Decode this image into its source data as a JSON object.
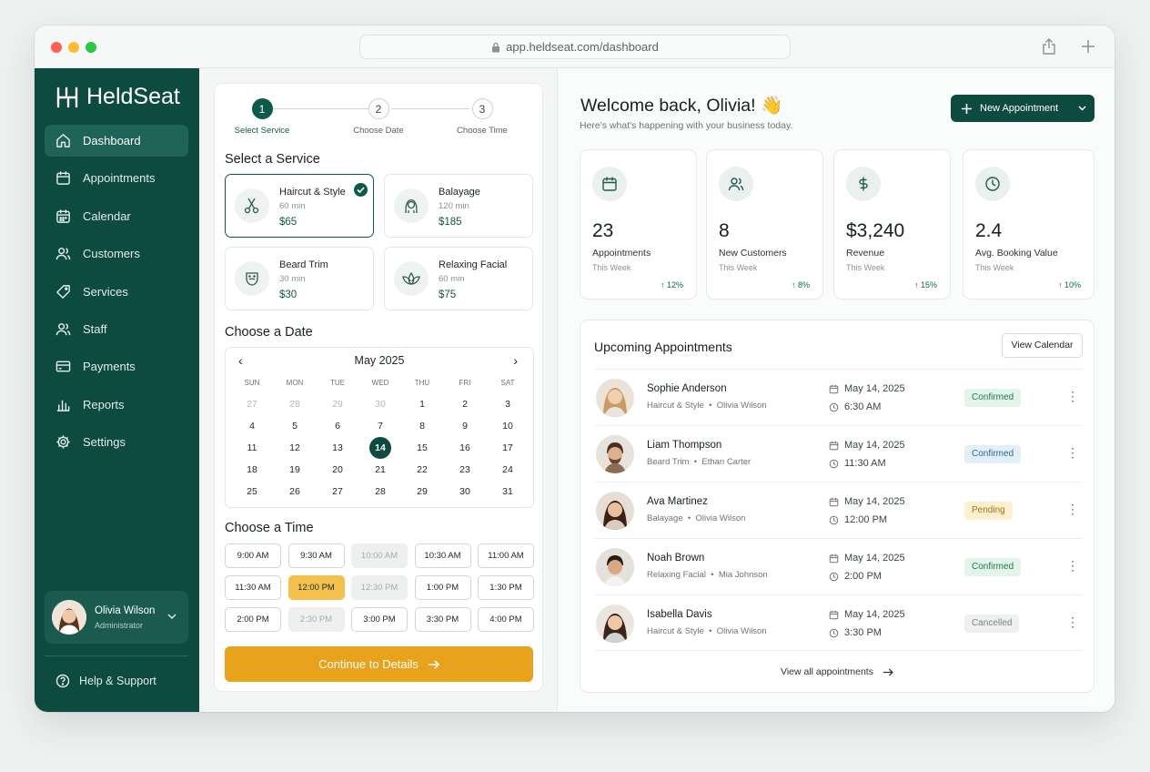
{
  "browser": {
    "url": "app.heldseat.com/dashboard"
  },
  "brand": {
    "name": "HeldSeat",
    "primary": "#0d4a40",
    "accent": "#e8a21b"
  },
  "sidebar": {
    "items": [
      {
        "label": "Dashboard",
        "icon": "home-icon",
        "active": true
      },
      {
        "label": "Appointments",
        "icon": "calendar-icon"
      },
      {
        "label": "Calendar",
        "icon": "calendar-grid-icon"
      },
      {
        "label": "Customers",
        "icon": "users-icon"
      },
      {
        "label": "Services",
        "icon": "tag-icon"
      },
      {
        "label": "Staff",
        "icon": "staff-icon"
      },
      {
        "label": "Payments",
        "icon": "card-icon"
      },
      {
        "label": "Reports",
        "icon": "bar-chart-icon"
      },
      {
        "label": "Settings",
        "icon": "gear-icon"
      }
    ],
    "profile": {
      "name": "Olivia Wilson",
      "role": "Administrator"
    },
    "help": "Help & Support"
  },
  "booking": {
    "steps": [
      {
        "num": "1",
        "label": "Select Service"
      },
      {
        "num": "2",
        "label": "Choose Date"
      },
      {
        "num": "3",
        "label": "Choose Time"
      }
    ],
    "service_heading": "Select a Service",
    "services": [
      {
        "name": "Haircut & Style",
        "duration": "60 min",
        "price": "$65",
        "selected": true
      },
      {
        "name": "Balayage",
        "duration": "120 min",
        "price": "$185"
      },
      {
        "name": "Beard Trim",
        "duration": "30 min",
        "price": "$30"
      },
      {
        "name": "Relaxing Facial",
        "duration": "60 min",
        "price": "$75"
      }
    ],
    "date_heading": "Choose a Date",
    "calendar": {
      "month": "May 2025",
      "prev": "‹",
      "next": "›",
      "weekdays": [
        "SUN",
        "MON",
        "TUE",
        "WED",
        "THU",
        "FRI",
        "SAT"
      ],
      "days": [
        [
          "27",
          "28",
          "29",
          "30",
          "1",
          "2",
          "3"
        ],
        [
          "4",
          "5",
          "6",
          "7",
          "8",
          "9",
          "10"
        ],
        [
          "11",
          "12",
          "13",
          "14",
          "15",
          "16",
          "17"
        ],
        [
          "18",
          "19",
          "20",
          "21",
          "22",
          "23",
          "24"
        ],
        [
          "25",
          "26",
          "27",
          "28",
          "29",
          "30",
          "31"
        ]
      ],
      "selected_day": "14"
    },
    "time_heading": "Choose a Time",
    "slots": [
      {
        "t": "9:00 AM"
      },
      {
        "t": "9:30 AM"
      },
      {
        "t": "10:00 AM",
        "state": "disabled"
      },
      {
        "t": "10:30 AM"
      },
      {
        "t": "11:00 AM"
      },
      {
        "t": "11:30 AM"
      },
      {
        "t": "12:00 PM",
        "state": "selected"
      },
      {
        "t": "12:30 PM",
        "state": "disabled"
      },
      {
        "t": "1:00 PM"
      },
      {
        "t": "1:30 PM"
      },
      {
        "t": "2:00 PM"
      },
      {
        "t": "2:30 PM",
        "state": "disabled"
      },
      {
        "t": "3:00 PM"
      },
      {
        "t": "3:30 PM"
      },
      {
        "t": "4:00 PM"
      }
    ],
    "cta": "Continue to Details"
  },
  "dashboard": {
    "welcome": "Welcome back, Olivia! 👋",
    "subtitle": "Here's what's happening with your business today.",
    "new_button": "New Appointment",
    "stats": [
      {
        "value": "23",
        "label": "Appointments",
        "period": "This Week",
        "change": "↑ 12%",
        "icon": "calendar-icon"
      },
      {
        "value": "8",
        "label": "New Customers",
        "period": "This Week",
        "change": "↑ 8%",
        "icon": "users-icon"
      },
      {
        "value": "$3,240",
        "label": "Revenue",
        "period": "This Week",
        "change": "↑ 15%",
        "icon": "dollar-icon"
      },
      {
        "value": "2.4",
        "label": "Avg. Booking Value",
        "period": "This Week",
        "change": "↑ 10%",
        "icon": "clock-icon"
      }
    ],
    "upcoming_title": "Upcoming Appointments",
    "view_calendar": "View Calendar",
    "appointments": [
      {
        "name": "Sophie Anderson",
        "service": "Haircut & Style",
        "staff": "Olivia Wilson",
        "date": "May 14, 2025",
        "time": "6:30 AM",
        "status": "Confirmed",
        "status_color": "#e3f4ea"
      },
      {
        "name": "Liam Thompson",
        "service": "Beard Trim",
        "staff": "Ethan Carter",
        "date": "May 14, 2025",
        "time": "11:30 AM",
        "status": "Confirmed",
        "status_color": "#e2eff8"
      },
      {
        "name": "Ava Martinez",
        "service": "Balayage",
        "staff": "Olivia Wilson",
        "date": "May 14, 2025",
        "time": "12:00 PM",
        "status": "Pending",
        "status_color": "#fdf0cf"
      },
      {
        "name": "Noah Brown",
        "service": "Relaxing Facial",
        "staff": "Mia Johnson",
        "date": "May 14, 2025",
        "time": "2:00 PM",
        "status": "Confirmed",
        "status_color": "#e3f4ea"
      },
      {
        "name": "Isabella Davis",
        "service": "Haircut & Style",
        "staff": "Olivia Wilson",
        "date": "May 14, 2025",
        "time": "3:30 PM",
        "status": "Cancelled",
        "status_color": "#eef0f0"
      }
    ],
    "view_all": "View all appointments"
  }
}
